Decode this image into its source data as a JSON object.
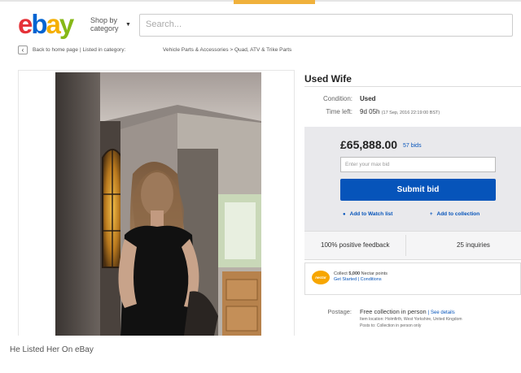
{
  "header": {
    "logo_letters": [
      {
        "char": "e",
        "color": "#e53238"
      },
      {
        "char": "b",
        "color": "#0064d2"
      },
      {
        "char": "a",
        "color": "#f5af02"
      },
      {
        "char": "y",
        "color": "#86b817"
      }
    ],
    "shop_by_line1": "Shop by",
    "shop_by_line2": "category",
    "search_placeholder": "Search..."
  },
  "nav": {
    "back_label": "Back to home page",
    "listed_label": "| Listed in category:",
    "breadcrumb": "Vehicle Parts & Accessories > Quad, ATV & Trike Parts"
  },
  "listing": {
    "title": "Used Wife",
    "condition_label": "Condition:",
    "condition_value": "Used",
    "time_left_label": "Time left:",
    "time_left_value": "9d 05h",
    "time_left_detail": "(17 Sep, 2016  22:19:00 BST)",
    "price": "£65,888.00",
    "bid_count": "57 bids",
    "max_bid_placeholder": "Enter your max bid",
    "submit_label": "Submit bid",
    "watch_label": "Add to Watch list",
    "collection_label": "Add to collection",
    "feedback": "100% positive feedback",
    "inquiries": "25 inquiries",
    "nectar_logo": "nectar",
    "nectar_line1_pre": "Collect",
    "nectar_points": "5,000",
    "nectar_line1_post": "Nectar points",
    "nectar_line2": "Get Started | Conditions",
    "postage_label": "Postage:",
    "postage_value": "Free collection in person",
    "postage_see": "| See details",
    "postage_item_location": "Item location:  Holmfirth, West Yorkshire, United Kingdom",
    "postage_posts_to": "Posts to:  Collection in person only"
  },
  "colors": {
    "submit": "#0654ba",
    "link": "#0654ba",
    "accent_bar": "#f0b13c"
  },
  "caption": "He Listed Her On eBay"
}
